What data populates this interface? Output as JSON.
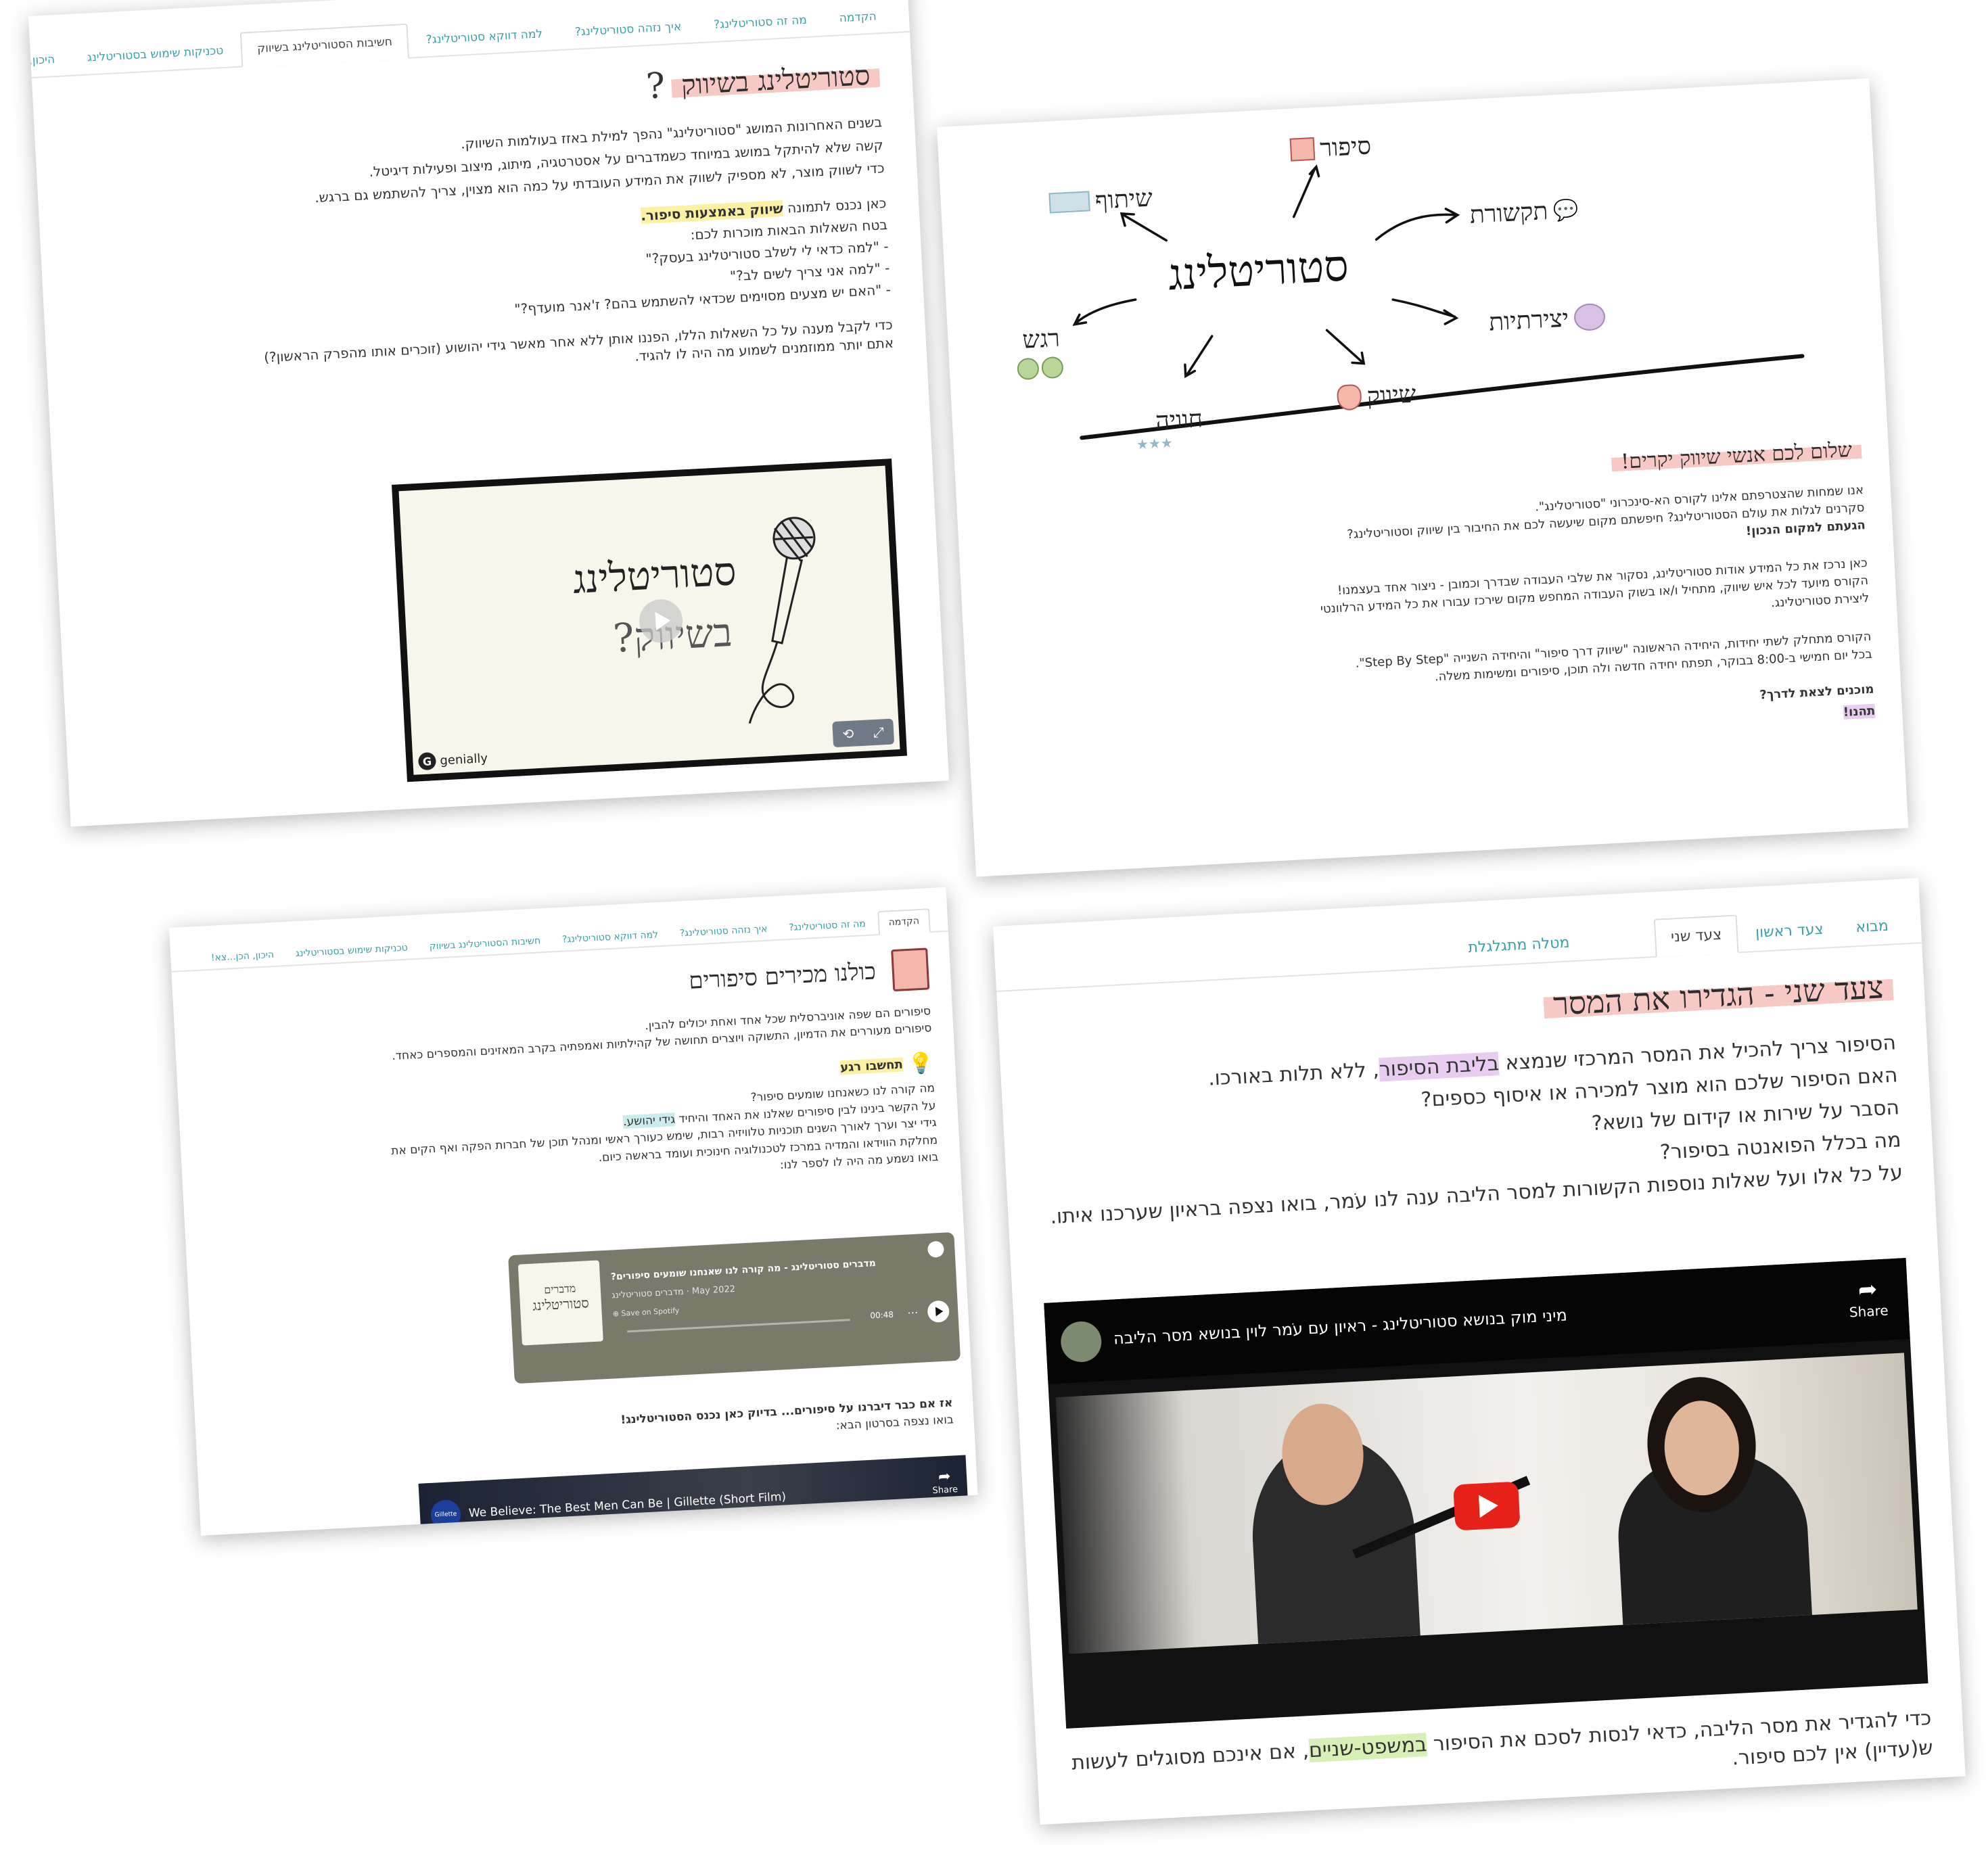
{
  "panel_a": {
    "tabs": [
      "הקדמה",
      "מה זה סטוריטלינג?",
      "איך נזהה סטוריטלינג?",
      "למה דווקא סטוריטלינג?",
      "חשיבות הסטוריטלינג בשיווק",
      "טכניקות שימוש בסטוריטלינג",
      "היכון, הכן...צא!"
    ],
    "active_tab": 4,
    "title": "סטוריטלינג בשיווק",
    "paragraph1": [
      "בשנים האחרונות המושג \"סטוריטלינג\" נהפך למילת באזז בעולמות השיווק.",
      "קשה שלא להיתקל במושג במיוחד כשמדברים על אסטרטגיה, מיתוג, מיצוב ופעילות דיגיטל.",
      "כדי לשווק מוצר, לא מספיק לשווק את המידע העובדתי על כמה הוא מצוין, צריך להשתמש גם ברגש."
    ],
    "intro_lead": "כאן נכנס לתמונה ",
    "intro_highlight": "שיווק באמצעות סיפור.",
    "questions_intro": "בטח השאלות הבאות מוכרות לכם:",
    "questions": [
      "- \"למה כדאי לי לשלב סטוריטלינג בעסק?\"",
      "- \"למה אני צריך לשים לב?\"",
      "- \"האם יש מצעים מסוימים שכדאי להשתמש בהם? ז'אנר מועדף?\""
    ],
    "closing": [
      "כדי לקבל מענה על כל השאלות הללו, הפננו אותן ללא אחר מאשר גידי יהושוע (זוכרים אותו מהפרק הראשון?)",
      "אתם יותר ממוזמנים לשמוע מה היה לו להגיד."
    ],
    "embed_title_line1": "סטוריטלינג",
    "embed_title_line2": "בשיווק?",
    "embed_brand": "genially"
  },
  "panel_b": {
    "center_word": "סטוריטלינג",
    "branches": [
      "סיפור",
      "תקשורת",
      "יצירתיות",
      "שיווק",
      "חוויה",
      "רגש",
      "שיתוף"
    ],
    "title": "שלום לכם אנשי שיווק יקרים!",
    "p1": [
      "אנו שמחות שהצטרפתם אלינו לקורס הא-סינכרוני \"סטוריטלינג\".",
      "סקרנים לגלות את עולם הסטוריטלינג? חיפשתם מקום שיעשה לכם את החיבור בין שיווק וסטוריטלינג?",
      "הגעתם למקום הנכון!"
    ],
    "p2": [
      "כאן נרכז את כל המידע אודות סטוריטלינג, נסקור את שלבי העבודה שבדרך וכמובן - ניצור אחד בעצמנו!",
      "הקורס מיועד לכל איש שיווק, מתחיל ו/או בשוק העבודה המחפש מקום שירכז עבורו את כל המידע הרלוונטי",
      "ליצירת סטוריטלינג."
    ],
    "p3": [
      "הקורס מתחלק לשתי יחידות, היחידה הראשונה \"שיווק דרך סיפור\" והיחידה השנייה \"Step By Step\".",
      "בכל יום חמישי ב-8:00 בבוקר, תפתח יחידה חדשה ולה תוכן, סיפורים ומשימות משלה."
    ],
    "ready": "מוכנים לצאת לדרך?",
    "enjoy": "תהנו!"
  },
  "panel_c": {
    "tabs": [
      "הקדמה",
      "מה זה סטוריטלינג?",
      "איך נזהה סטוריטלינג?",
      "למה דווקא סטוריטלינג?",
      "חשיבות הסטוריטלינג בשיווק",
      "טכניקות שימוש בסטוריטלינג",
      "היכון, הכן...צא!"
    ],
    "active_tab": 0,
    "title": "כולנו מכירים סיפורים",
    "p1": [
      "סיפורים הם שפה אוניברסלית שכל אחד ואחת יכולים להבין.",
      "סיפורים מעוררים את הדמיון, התשוקה ויוצרים תחושה של קהילתיות ואמפתיה בקרב המאזינים והמספרים כאחד."
    ],
    "think_label": "תחשבו רגע",
    "think_q": "מה קורה לנו כשאנחנו שומעים סיפור?",
    "link_lead": "על הקשר בינינו לבין סיפורים שאלנו את האחד והיחיד ",
    "link_name": "גידי יהושע.",
    "bio": [
      "גידי יצר וערך לאורך השנים תוכניות טלוויזיה רבות, שימש כעורך ראשי ומנהל תוכן של חברות הפקה ואף הקים את",
      "מחלקת הווידאו והמדיה במרכז לטכנולוגיה חינוכית ועומד בראשה כיום.",
      "בואו נשמע מה היה לו לספר לנו:"
    ],
    "spotify": {
      "title": "מדברים סטוריטלינג - מה קורה לנו שאנחנו שומעים סיפורים?",
      "meta": "May 2022 · מדברים סטוריטלינג",
      "save": "Save on Spotify",
      "time": "00:48",
      "cover_line1": "מדברים",
      "cover_line2": "סטוריטלינג"
    },
    "outro": [
      "אז אם כבר דיברנו על סיפורים... בדיוק כאן נכנס הסטוריטלינג!",
      "בואו נצפה בסרטון הבא:"
    ],
    "video_title": "We Believe: The Best Men Can Be | Gillette (Short Film)",
    "video_share": "Share",
    "channel": "Gillette"
  },
  "panel_d": {
    "tabs": [
      "מבוא",
      "צעד ראשון",
      "צעד שני",
      "מטלה מתגלגלת"
    ],
    "active_tab": 2,
    "title": "צעד שני - הגדירו את המסר",
    "l1_lead": "הסיפור צריך להכיל את המסר המרכזי שנמצא ",
    "l1_highlight": "בליבת הסיפור",
    "l1_tail": ", ללא תלות באורכו.",
    "questions": [
      "האם הסיפור שלכם הוא מוצר למכירה או איסוף כספים?",
      "הסבר על שירות או קידום של נושא?",
      "מה בכלל הפואנטה בסיפור?"
    ],
    "l5": "על כל אלו ועל שאלות נוספות הקשורות למסר הליבה ענה לנו עֹמר, בואו נצפה בראיון שערכנו איתו.",
    "video_title": "מיני מוק בנושא סטוריטלינג - ראיון עם עֹמר לוין בנושא מסר הליבה",
    "video_share": "Share",
    "bottom_lead": "כדי להגדיר את מסר הליבה, כדאי לנסות לסכם את הסיפור ",
    "bottom_highlight": "במשפט-שניים",
    "bottom_tail": ", אם אינכם מסוגלים לעשות",
    "bottom_line2": "ש(עדיין) אין לכם סיפור."
  }
}
